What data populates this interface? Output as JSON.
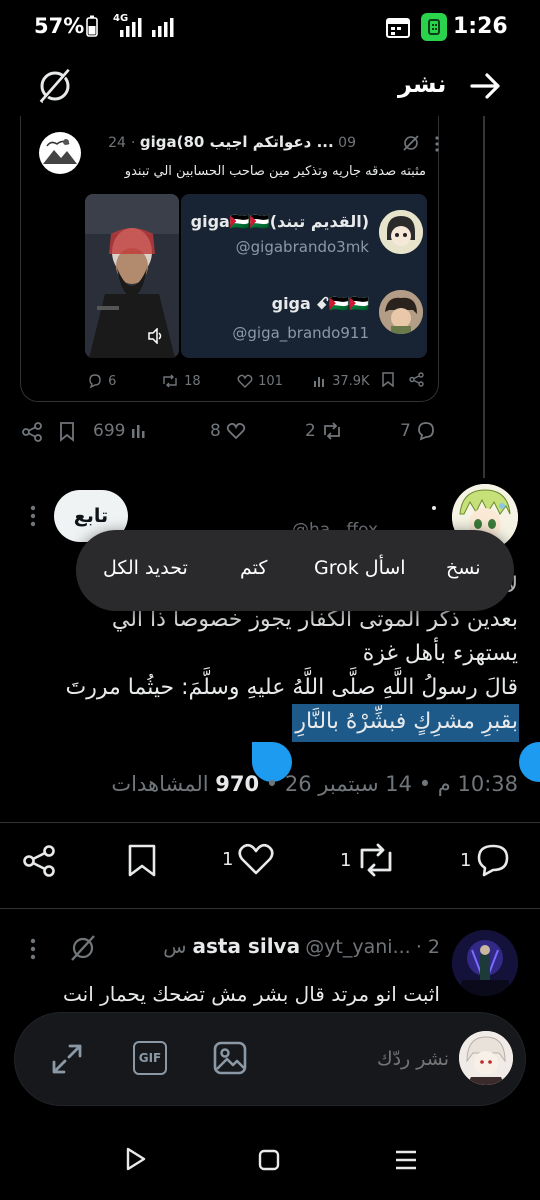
{
  "status_bar": {
    "battery_pct": "57%",
    "network": "4G",
    "time": "1:26"
  },
  "header": {
    "title": "نشر"
  },
  "quoted_tweet": {
    "author_name": "giga(80 دعواتكم اجيب ...",
    "date": "09 Sept 24",
    "text": "مثبته صدقه جاريه وتذكير مين صاحب الحسابين الي تبندو",
    "accounts": [
      {
        "name": "(القديم تبند)giga🇵🇸🇵🇸",
        "handle": "@gigabrando3mk"
      },
      {
        "name": "giga ꗃ🇵🇸🇵🇸",
        "handle": "@giga_brando911"
      }
    ],
    "stats": {
      "replies": "6",
      "reposts": "18",
      "likes": "101",
      "views": "37.9K"
    }
  },
  "parent_actions": {
    "views": "699",
    "likes": "8",
    "reposts": "2",
    "replies": "7"
  },
  "main_post": {
    "follow_label": "تابع",
    "handle_partial": "@ha...ffox",
    "lines": [
      "لا",
      "بعدين ذكر الموتى الكفار يجوز خصوصا ذا الي",
      "يستهزء بأهل غزة",
      "قالَ رسولُ اللَّهِ صلَّى اللَّهُ عليهِ وسلَّمَ: حيثُما مررتَ",
      "بقبرِ مشرِكٍ فبشِّرْهُ بالنَّارِ"
    ],
    "time": "10:38 م",
    "date": "14 سبتمبر 26",
    "views_count": "970",
    "views_label": "المشاهدات"
  },
  "context_menu": {
    "copy": "نسخ",
    "ask_grok": "اسأل Grok",
    "mute": "كتم",
    "select_all": "تحديد الكل"
  },
  "action_bar": {
    "replies": "1",
    "reposts": "1",
    "likes": "1"
  },
  "reply": {
    "author": "asta silva",
    "handle": "@yt_yani...",
    "time": "2 س",
    "text": "اثبت انو مرتد قال بشر مش تضحك يحمار انت"
  },
  "composer": {
    "placeholder": "نشر ردّك",
    "gif_label": "GIF"
  },
  "colors": {
    "background": "#000000",
    "selection": "#1d5a8a",
    "handle": "#1d9bf0",
    "muted": "#71767b"
  }
}
